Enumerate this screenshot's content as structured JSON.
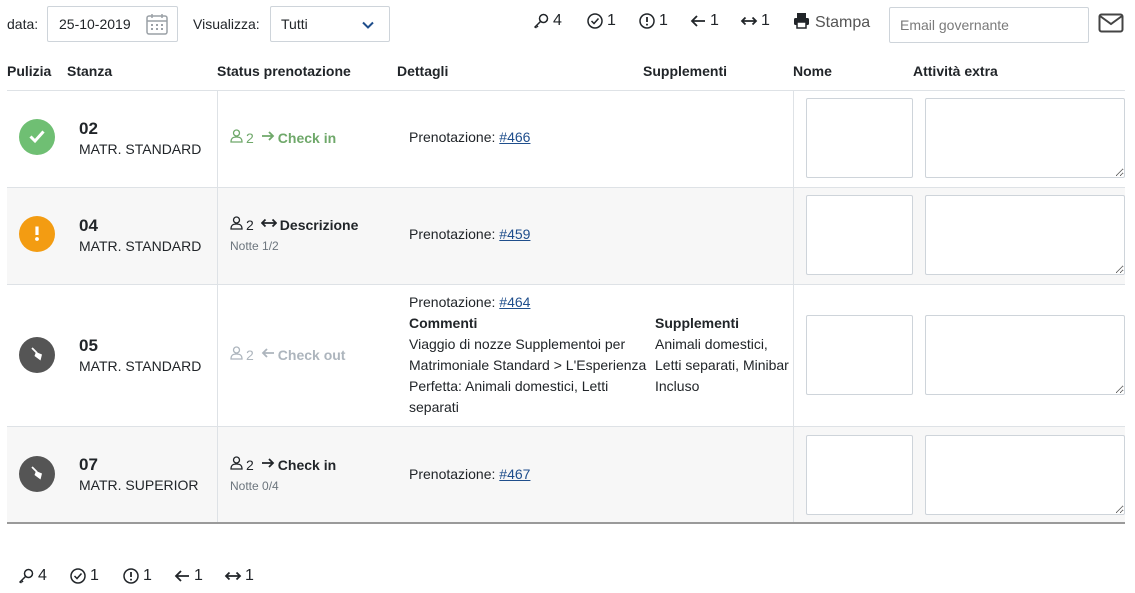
{
  "toolbar": {
    "date_label": "data:",
    "date_value": "25-10-2019",
    "view_label": "Visualizza:",
    "view_value": "Tutti",
    "stats": [
      {
        "icon": "key-icon",
        "value": "4"
      },
      {
        "icon": "check-circle-icon",
        "value": "1"
      },
      {
        "icon": "exclamation-circle-icon",
        "value": "1"
      },
      {
        "icon": "arrow-left-icon",
        "value": "1"
      },
      {
        "icon": "arrows-horizontal-icon",
        "value": "1"
      }
    ],
    "print_label": "Stampa",
    "email_placeholder": "Email governante"
  },
  "table": {
    "headers": [
      "Pulizia",
      "Stanza",
      "Status prenotazione",
      "Dettagli",
      "Supplementi",
      "Nome",
      "Attività extra"
    ],
    "rows": [
      {
        "cleaning": "clean",
        "cleaning_color": "#6fbf73",
        "room_number": "02",
        "room_type": "MATR. STANDARD",
        "guests": "2",
        "action": "Check in",
        "nights": "",
        "booking_label": "Prenotazione:",
        "booking_link": "#466"
      },
      {
        "cleaning": "warning",
        "cleaning_color": "#f39c12",
        "room_number": "04",
        "room_type": "MATR. STANDARD",
        "guests": "2",
        "action": "Descrizione",
        "nights": "Notte 1/2",
        "booking_label": "Prenotazione:",
        "booking_link": "#459"
      },
      {
        "cleaning": "to-clean",
        "cleaning_color": "#555555",
        "room_number": "05",
        "room_type": "MATR. STANDARD",
        "guests": "2",
        "action": "Check out",
        "nights": "",
        "booking_label": "Prenotazione:",
        "booking_link": "#464",
        "comments_title": "Commenti",
        "comments_lines": [
          "Viaggio di nozze Supplementoi per",
          "Matrimoniale Standard > L'Esperienza",
          "Perfetta: Animali domestici, Letti",
          "separati"
        ],
        "supplements_title": "Supplementi",
        "supplements_lines": [
          "Animali domestici,",
          "Letti separati, Minibar",
          "Incluso"
        ]
      },
      {
        "cleaning": "to-clean",
        "cleaning_color": "#555555",
        "room_number": "07",
        "room_type": "MATR. SUPERIOR",
        "guests": "2",
        "action": "Check in",
        "nights": "Notte 0/4",
        "booking_label": "Prenotazione:",
        "booking_link": "#467"
      }
    ]
  },
  "footer": {
    "stats": [
      {
        "icon": "key-icon",
        "value": "4"
      },
      {
        "icon": "check-circle-icon",
        "value": "1"
      },
      {
        "icon": "exclamation-circle-icon",
        "value": "1"
      },
      {
        "icon": "arrow-left-icon",
        "value": "1"
      },
      {
        "icon": "arrows-horizontal-icon",
        "value": "1"
      }
    ]
  },
  "colors": {
    "accent_link": "#1f4e8c",
    "checkin_green": "#6fa86a",
    "muted": "#adb5bd"
  }
}
